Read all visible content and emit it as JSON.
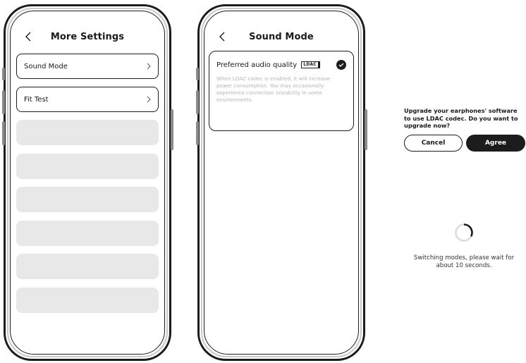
{
  "more_settings": {
    "title": "More Settings",
    "items": [
      {
        "label": "Sound Mode"
      },
      {
        "label": "Fit Test"
      }
    ]
  },
  "sound_mode": {
    "title": "Sound Mode",
    "option_label": "Preferred audio quality",
    "badge": "LDAC",
    "selected": true,
    "description": "When LDAC codec is enabled, it will increase power consumption. You may occasionally experience connection instability in some environments."
  },
  "dialog": {
    "message": "Upgrade your earphones' software to use LDAC codec. Do you want to upgrade now?",
    "cancel_label": "Cancel",
    "agree_label": "Agree"
  },
  "loading": {
    "message": "Switching modes, please wait for about 10 seconds."
  },
  "colors": {
    "primary": "#1c1c1c",
    "placeholder": "#e8e8e8",
    "muted_text": "#b5b5b5"
  }
}
